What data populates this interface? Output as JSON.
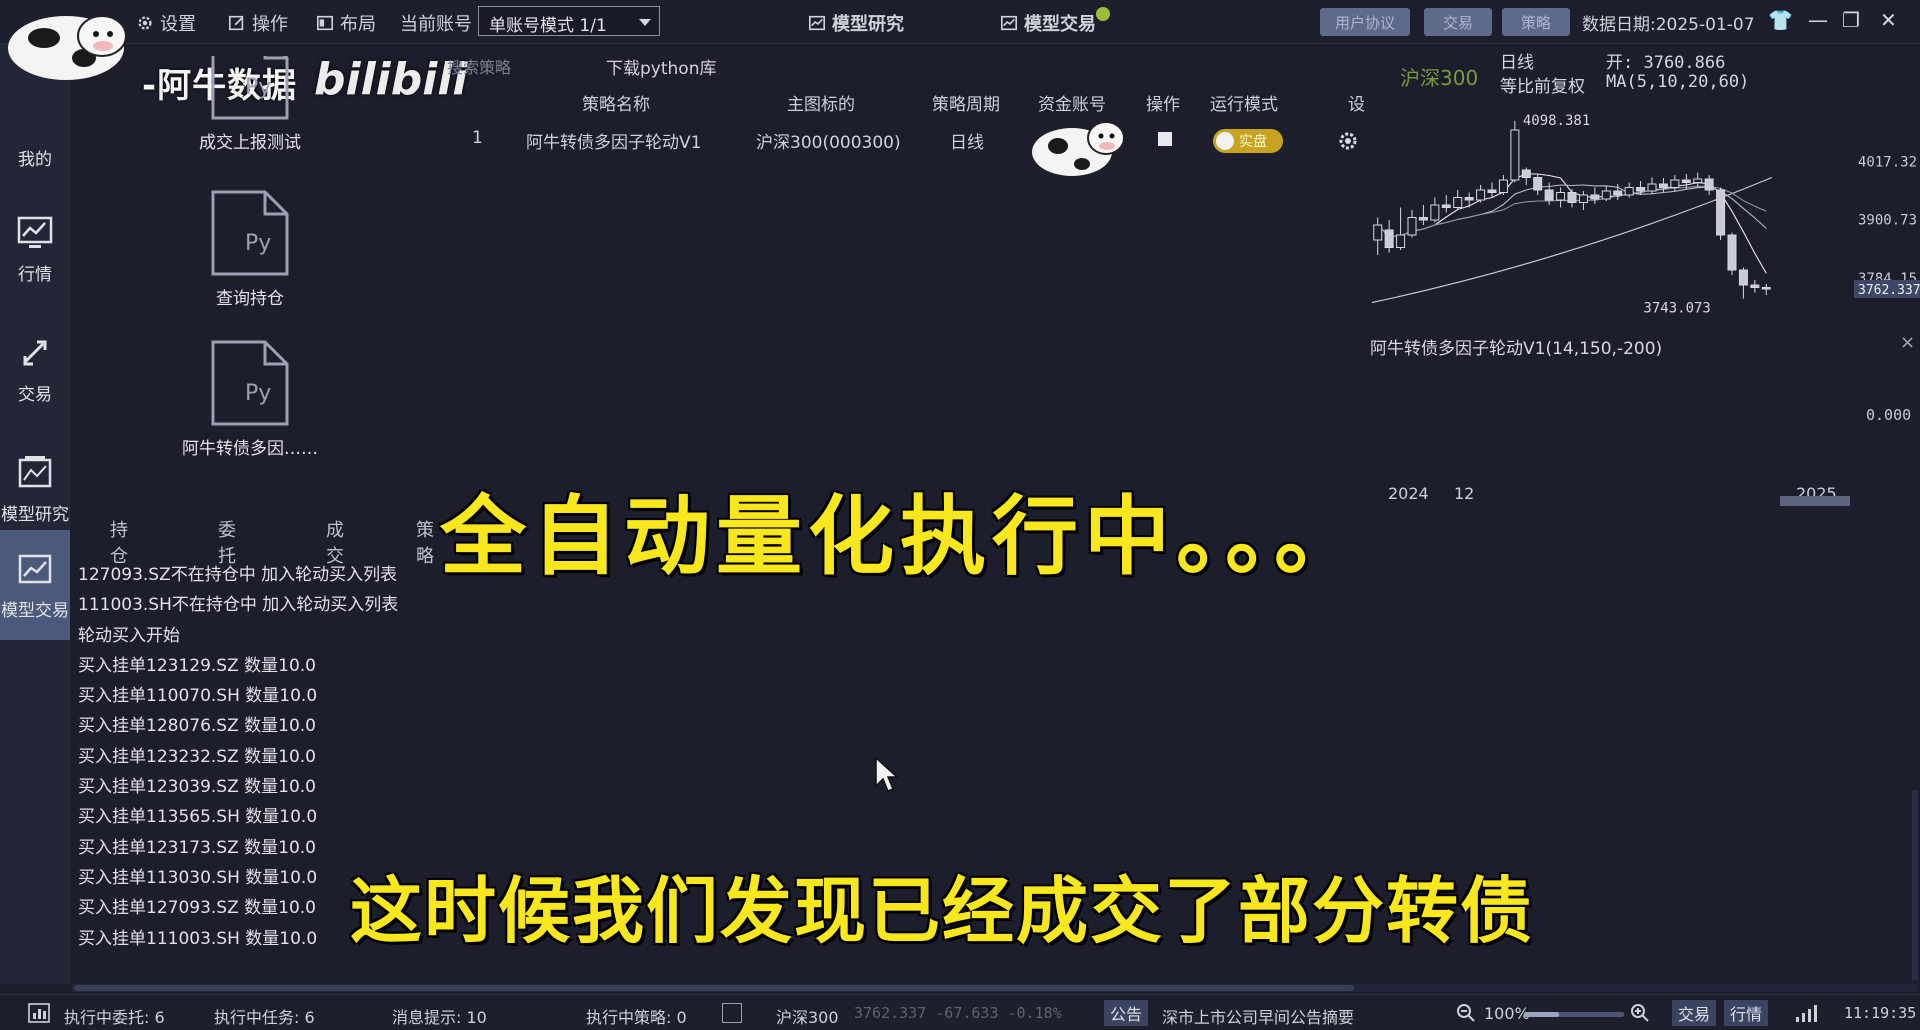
{
  "toolbar": {
    "settings": "设置",
    "operate": "操作",
    "layout": "布局",
    "current_account_label": "当前账号",
    "account_mode": "单账号模式 1/1",
    "model_research": "模型研究",
    "model_trading": "模型交易",
    "btn_user_rights": "用户协议",
    "btn_trade": "交易",
    "btn_strategy": "策略",
    "data_date": "数据日期:2025-01-07"
  },
  "logo": {
    "text": "-阿牛数据",
    "bili": "bilibili"
  },
  "sidebar": {
    "items": [
      {
        "label": "我的"
      },
      {
        "label": "行情"
      },
      {
        "label": "交易"
      },
      {
        "label": "模型研究"
      },
      {
        "label": "模型交易"
      }
    ]
  },
  "strategy_panel": {
    "search_placeholder": "搜索策略",
    "download_python": "下载python库",
    "files": [
      {
        "icon_text": "Py",
        "label": "成交上报测试"
      },
      {
        "icon_text": "Py",
        "label": "查询持仓"
      },
      {
        "icon_text": "Py",
        "label": "阿牛转债多因……"
      }
    ],
    "columns": [
      "策略名称",
      "主图标的",
      "策略周期",
      "资金账号",
      "操作",
      "运行模式",
      "设"
    ],
    "rows": [
      {
        "index": "1",
        "name": "阿牛转债多因子轮动V1",
        "symbol": "沪深300(000300)",
        "period": "日线",
        "mode": "实盘"
      }
    ]
  },
  "chart_header": {
    "symbol": "沪深300",
    "period": "日线",
    "adjust": "等比前复权",
    "open_label": "开: 3760.866",
    "ma_label": "MA(5,10,20,60)"
  },
  "chart_data": {
    "type": "candlestick",
    "title": "沪深300",
    "price_labels": {
      "high": "4098.381",
      "low": "3743.073",
      "last": "3762.337"
    },
    "y_ticks": [
      "4017.32",
      "3900.73",
      "3784.15"
    ],
    "x_ticks": [
      "2024",
      "12",
      "2025"
    ],
    "candles": [
      {
        "o": 3860,
        "c": 3890,
        "h": 3905,
        "l": 3830
      },
      {
        "o": 3880,
        "c": 3845,
        "h": 3900,
        "l": 3835
      },
      {
        "o": 3845,
        "c": 3870,
        "h": 3925,
        "l": 3840
      },
      {
        "o": 3870,
        "c": 3905,
        "h": 3920,
        "l": 3865
      },
      {
        "o": 3905,
        "c": 3900,
        "h": 3930,
        "l": 3890
      },
      {
        "o": 3900,
        "c": 3930,
        "h": 3945,
        "l": 3895
      },
      {
        "o": 3930,
        "c": 3925,
        "h": 3950,
        "l": 3915
      },
      {
        "o": 3925,
        "c": 3945,
        "h": 3960,
        "l": 3920
      },
      {
        "o": 3945,
        "c": 3940,
        "h": 3955,
        "l": 3925
      },
      {
        "o": 3940,
        "c": 3960,
        "h": 3970,
        "l": 3935
      },
      {
        "o": 3960,
        "c": 3955,
        "h": 3975,
        "l": 3945
      },
      {
        "o": 3955,
        "c": 3980,
        "h": 3990,
        "l": 3950
      },
      {
        "o": 3980,
        "c": 4080,
        "h": 4098,
        "l": 3975
      },
      {
        "o": 4000,
        "c": 3985,
        "h": 4005,
        "l": 3970
      },
      {
        "o": 3985,
        "c": 3960,
        "h": 3992,
        "l": 3950
      },
      {
        "o": 3960,
        "c": 3940,
        "h": 3975,
        "l": 3930
      },
      {
        "o": 3940,
        "c": 3955,
        "h": 3965,
        "l": 3925
      },
      {
        "o": 3955,
        "c": 3935,
        "h": 3962,
        "l": 3925
      },
      {
        "o": 3935,
        "c": 3950,
        "h": 3958,
        "l": 3920
      },
      {
        "o": 3950,
        "c": 3942,
        "h": 3965,
        "l": 3932
      },
      {
        "o": 3942,
        "c": 3958,
        "h": 3968,
        "l": 3938
      },
      {
        "o": 3958,
        "c": 3950,
        "h": 3972,
        "l": 3940
      },
      {
        "o": 3950,
        "c": 3965,
        "h": 3975,
        "l": 3945
      },
      {
        "o": 3965,
        "c": 3958,
        "h": 3978,
        "l": 3950
      },
      {
        "o": 3958,
        "c": 3972,
        "h": 3985,
        "l": 3952
      },
      {
        "o": 3972,
        "c": 3965,
        "h": 3984,
        "l": 3955
      },
      {
        "o": 3965,
        "c": 3980,
        "h": 3990,
        "l": 3958
      },
      {
        "o": 3980,
        "c": 3975,
        "h": 3992,
        "l": 3962
      },
      {
        "o": 3975,
        "c": 3982,
        "h": 3995,
        "l": 3965
      },
      {
        "o": 3982,
        "c": 3960,
        "h": 3990,
        "l": 3950
      },
      {
        "o": 3960,
        "c": 3870,
        "h": 3965,
        "l": 3860
      },
      {
        "o": 3870,
        "c": 3800,
        "h": 3875,
        "l": 3790
      },
      {
        "o": 3800,
        "c": 3770,
        "h": 3805,
        "l": 3743
      },
      {
        "o": 3770,
        "c": 3765,
        "h": 3780,
        "l": 3755
      },
      {
        "o": 3765,
        "c": 3762,
        "h": 3772,
        "l": 3750
      }
    ],
    "ylim": [
      3720,
      4120
    ]
  },
  "sub_chart": {
    "caption": "阿牛转债多因子轮动V1(14,150,-200)",
    "zero": "0.000",
    "close": "×"
  },
  "lower_tabs": [
    "持仓",
    "委托",
    "成交",
    "策略"
  ],
  "log_lines": [
    "127093.SZ不在持仓中 加入轮动买入列表",
    "111003.SH不在持仓中 加入轮动买入列表",
    "轮动买入开始",
    "买入挂单123129.SZ 数量10.0",
    "买入挂单110070.SH 数量10.0",
    "买入挂单128076.SZ 数量10.0",
    "买入挂单123232.SZ 数量10.0",
    "买入挂单123039.SZ 数量10.0",
    "买入挂单113565.SH 数量10.0",
    "买入挂单123173.SZ 数量10.0",
    "买入挂单113030.SH 数量10.0",
    "买入挂单127093.SZ 数量10.0",
    "买入挂单111003.SH 数量10.0"
  ],
  "captions": {
    "line1": "全自动量化执行中。。。",
    "line2": "这时候我们发现已经成交了部分转债"
  },
  "statusbar": {
    "exec_orders": "执行中委托: 6",
    "exec_tasks": "执行中任务: 6",
    "messages": "消息提示: 10",
    "exec_strategies": "执行中策略: 0",
    "index_name": "沪深300",
    "index_quote": "3762.337  -67.633  -0.18%",
    "notice_btn": "公告",
    "notice_text": "深市上市公司早间公告摘要",
    "zoom": "100%",
    "zoom_fraction": 0.35,
    "btn_trade": "交易",
    "btn_quote": "行情",
    "time": "11:19:35"
  }
}
